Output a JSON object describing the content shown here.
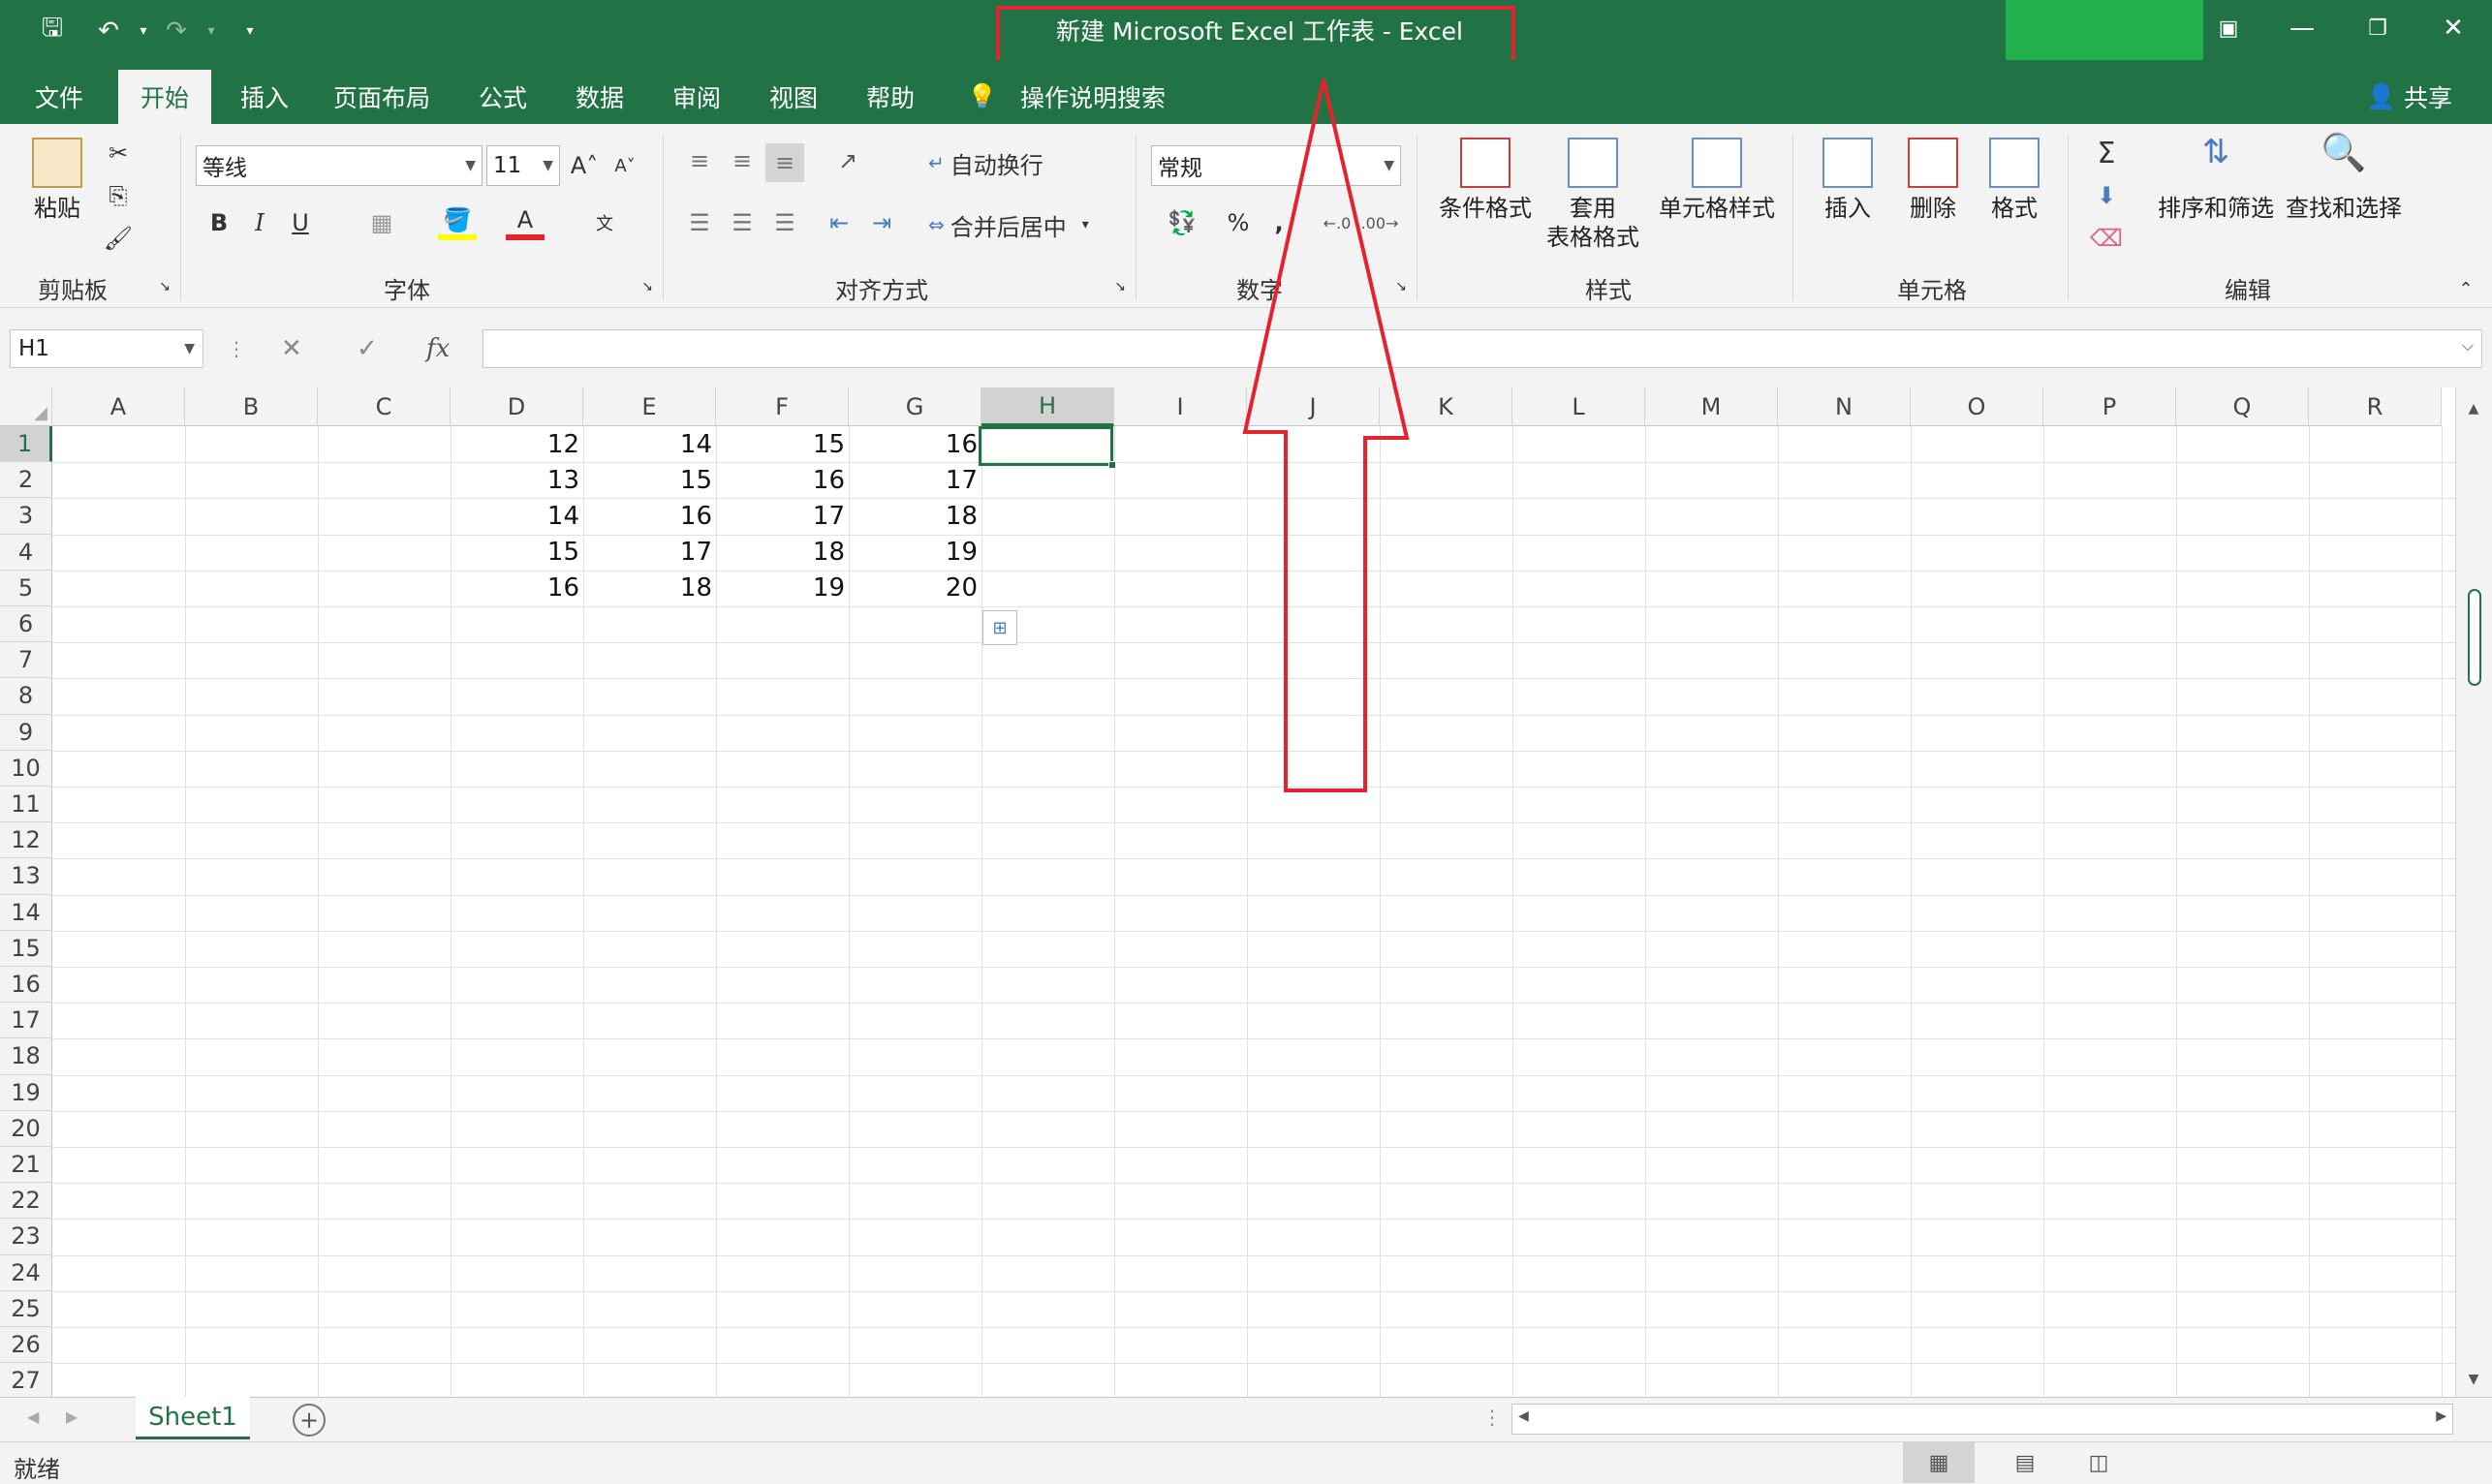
{
  "window": {
    "title": "新建 Microsoft Excel 工作表  -  Excel"
  },
  "tabs": [
    "文件",
    "开始",
    "插入",
    "页面布局",
    "公式",
    "数据",
    "审阅",
    "视图",
    "帮助"
  ],
  "search_label": "操作说明搜索",
  "share_label": "共享",
  "ribbon": {
    "clipboard": {
      "paste": "粘贴",
      "group": "剪贴板"
    },
    "font": {
      "name": "等线",
      "size": "11",
      "bold": "B",
      "italic": "I",
      "underline": "U",
      "group": "字体"
    },
    "align": {
      "wrap": "自动换行",
      "merge": "合并后居中",
      "group": "对齐方式"
    },
    "number": {
      "format": "常规",
      "percent": "%",
      "comma": ",",
      "group": "数字"
    },
    "styles": {
      "cond": "条件格式",
      "table1": "套用",
      "table2": "表格格式",
      "cell": "单元格样式",
      "group": "样式"
    },
    "cells": {
      "insert": "插入",
      "delete": "删除",
      "format": "格式",
      "group": "单元格"
    },
    "editing": {
      "sort": "排序和筛选",
      "find": "查找和选择",
      "group": "编辑"
    }
  },
  "formula": {
    "namebox": "H1",
    "value": ""
  },
  "columns": [
    "A",
    "B",
    "C",
    "D",
    "E",
    "F",
    "G",
    "H",
    "I",
    "J",
    "K",
    "L",
    "M",
    "N",
    "O",
    "P",
    "Q",
    "R"
  ],
  "rows": [
    "1",
    "2",
    "3",
    "4",
    "5",
    "6",
    "7",
    "8",
    "9",
    "10",
    "11",
    "12",
    "13",
    "14",
    "15",
    "16",
    "17",
    "18",
    "19",
    "20",
    "21",
    "22",
    "23",
    "24",
    "25",
    "26",
    "27"
  ],
  "cells": {
    "D": [
      "12",
      "13",
      "14",
      "15",
      "16"
    ],
    "E": [
      "14",
      "15",
      "16",
      "17",
      "18"
    ],
    "F": [
      "15",
      "16",
      "17",
      "18",
      "19"
    ],
    "G": [
      "16",
      "17",
      "18",
      "19",
      "20"
    ]
  },
  "sheet": {
    "name": "Sheet1"
  },
  "status": {
    "text": "就绪"
  },
  "colors": {
    "accent": "#217346",
    "annotation": "#e4232e"
  }
}
